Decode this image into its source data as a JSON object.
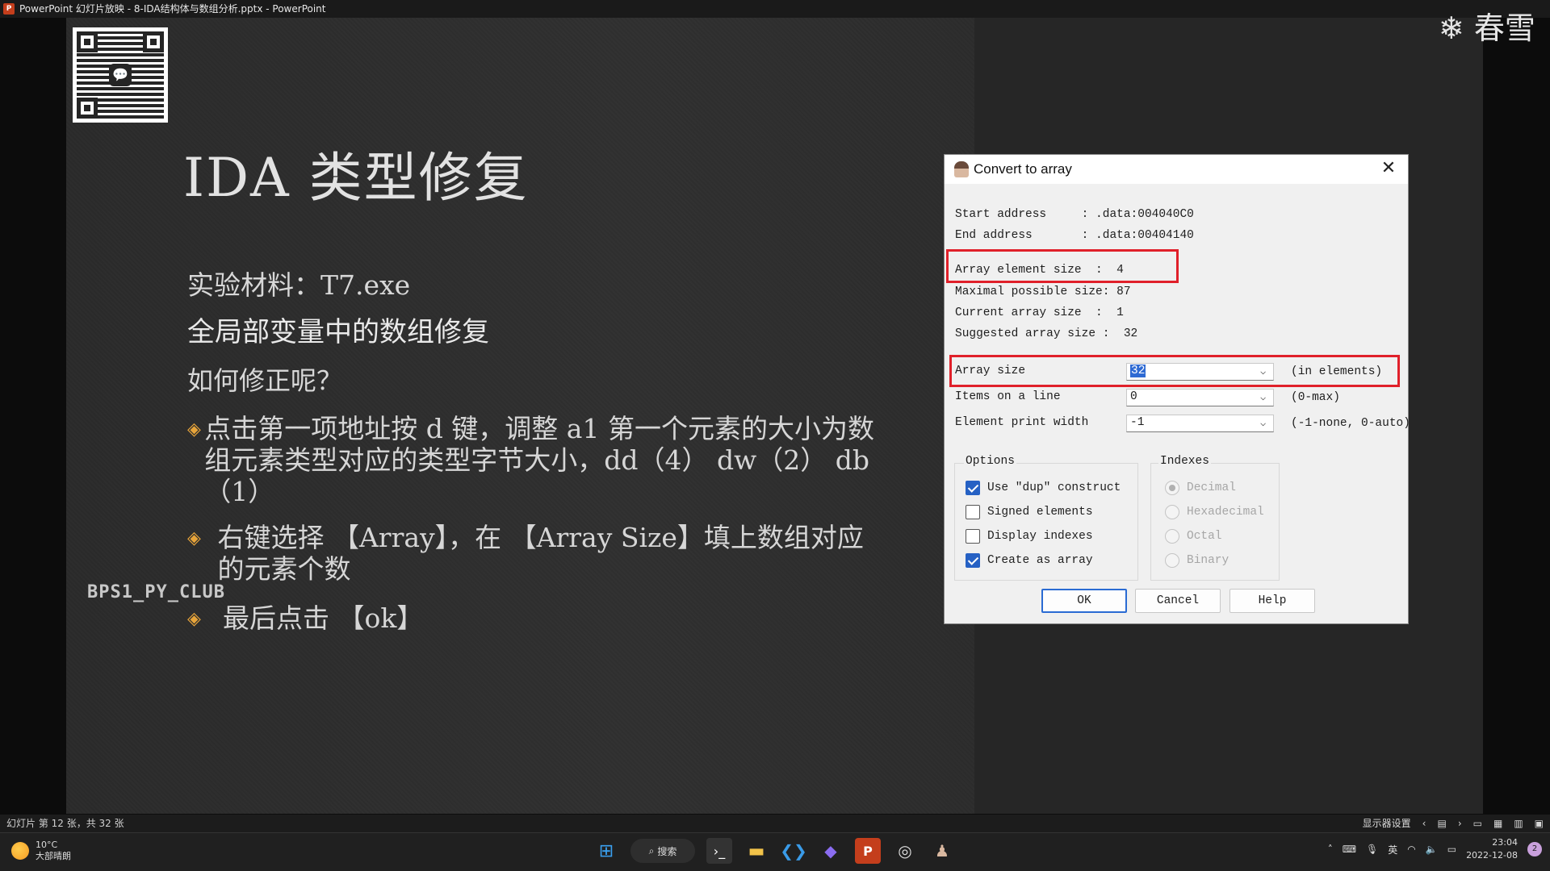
{
  "window": {
    "title": "PowerPoint 幻灯片放映 - 8-IDA结构体与数组分析.pptx - PowerPoint",
    "app_icon": "P"
  },
  "slide": {
    "title": "IDA 类型修复",
    "line1": "实验材料：T7.exe",
    "line2": "全局部变量中的数组修复",
    "line3": "如何修正呢？",
    "bullets": [
      "点击第一项地址按 d 键，调整 a1 第一个元素的大小为数组元素类型对应的类型字节大小，dd（4） dw（2） db（1）",
      "右键选择 【Array】，在 【Array Size】填上数组对应的元素个数",
      "最后点击 【ok】"
    ],
    "bullet_glyph": "◈",
    "watermark": "BPS1_PY_CLUB",
    "corner_logo": "❄ 春雪",
    "qr_center_glyph": "💬"
  },
  "dialog": {
    "title": "Convert to array",
    "close_glyph": "✕",
    "info": [
      {
        "label": "Start address     ",
        "value": ": .data:004040C0"
      },
      {
        "label": "End address       ",
        "value": ": .data:00404140"
      },
      {
        "label": "Array element size  ",
        "value": ":  4"
      },
      {
        "label": "Maximal possible size:",
        "value": " 87"
      },
      {
        "label": "Current array size  ",
        "value": ":  1"
      },
      {
        "label": "Suggested array size ",
        "value": ":  32"
      }
    ],
    "fields": {
      "array_size": {
        "label": "Array size",
        "value": "32",
        "hint": "(in elements)"
      },
      "items_on_line": {
        "label": "Items on a line",
        "value": "0",
        "hint": "(0-max)"
      },
      "element_print_width": {
        "label": "Element print width",
        "value": "-1",
        "hint": "(-1-none, 0-auto)"
      }
    },
    "options": {
      "label": "Options",
      "items": [
        {
          "label": "Use \"dup\" construct",
          "checked": true
        },
        {
          "label": "Signed elements",
          "checked": false
        },
        {
          "label": "Display indexes",
          "checked": false
        },
        {
          "label": "Create as array",
          "checked": true
        }
      ]
    },
    "indexes": {
      "label": "Indexes",
      "items": [
        {
          "label": "Decimal",
          "selected": true
        },
        {
          "label": "Hexadecimal",
          "selected": false
        },
        {
          "label": "Octal",
          "selected": false
        },
        {
          "label": "Binary",
          "selected": false
        }
      ]
    },
    "buttons": {
      "ok": "OK",
      "cancel": "Cancel",
      "help": "Help"
    },
    "combo_arrow": "⌵"
  },
  "statusbar": {
    "slide_info": "幻灯片 第 12 张，共 32 张",
    "display_settings": "显示器设置",
    "prev": "‹",
    "next": "›"
  },
  "taskbar": {
    "weather": {
      "temp": "10°C",
      "desc": "大部晴朗"
    },
    "search": "搜索",
    "clock": {
      "time": "23:04",
      "date": "2022-12-08"
    },
    "ime": "英",
    "notification_count": "2"
  },
  "colors": {
    "accent_red": "#e0202a",
    "selection_blue": "#2e6ad3",
    "bullet_orange": "#e7a43a"
  }
}
